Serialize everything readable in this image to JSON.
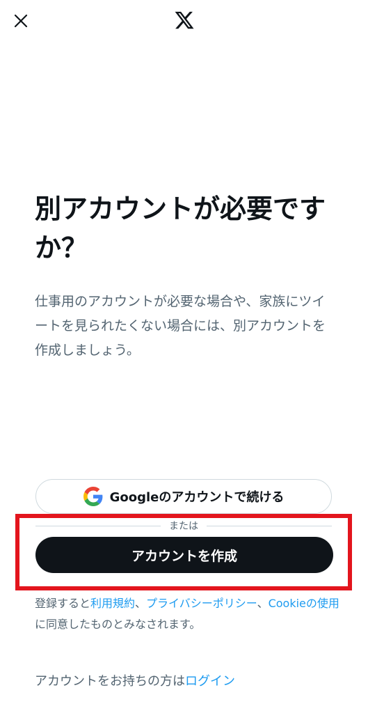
{
  "header": {
    "close_icon": "close-icon",
    "logo_icon": "x-logo-icon"
  },
  "main": {
    "headline": "別アカウントが必要ですか？",
    "description": "仕事用のアカウントが必要な場合や、家族にツイートを見られたくない場合には、別アカウントを作成しましょう。"
  },
  "google_button": {
    "label": "Googleのアカウントで続ける",
    "icon": "google-icon"
  },
  "divider": {
    "label": "または"
  },
  "create_button": {
    "label": "アカウントを作成"
  },
  "legal": {
    "prefix": "登録すると",
    "terms_link": "利用規約",
    "sep1": "、",
    "privacy_link": "プライバシーポリシー",
    "sep2": "、",
    "cookie_link": "Cookieの使用",
    "suffix": "に同意したものとみなされます。"
  },
  "login": {
    "prompt": "アカウントをお持ちの方は",
    "link": "ログイン"
  },
  "colors": {
    "text_primary": "#0f1419",
    "text_secondary": "#536471",
    "link": "#1d9bf0",
    "button_dark": "#0f1419",
    "highlight_red": "#e3151d",
    "border": "#cfd9de"
  }
}
